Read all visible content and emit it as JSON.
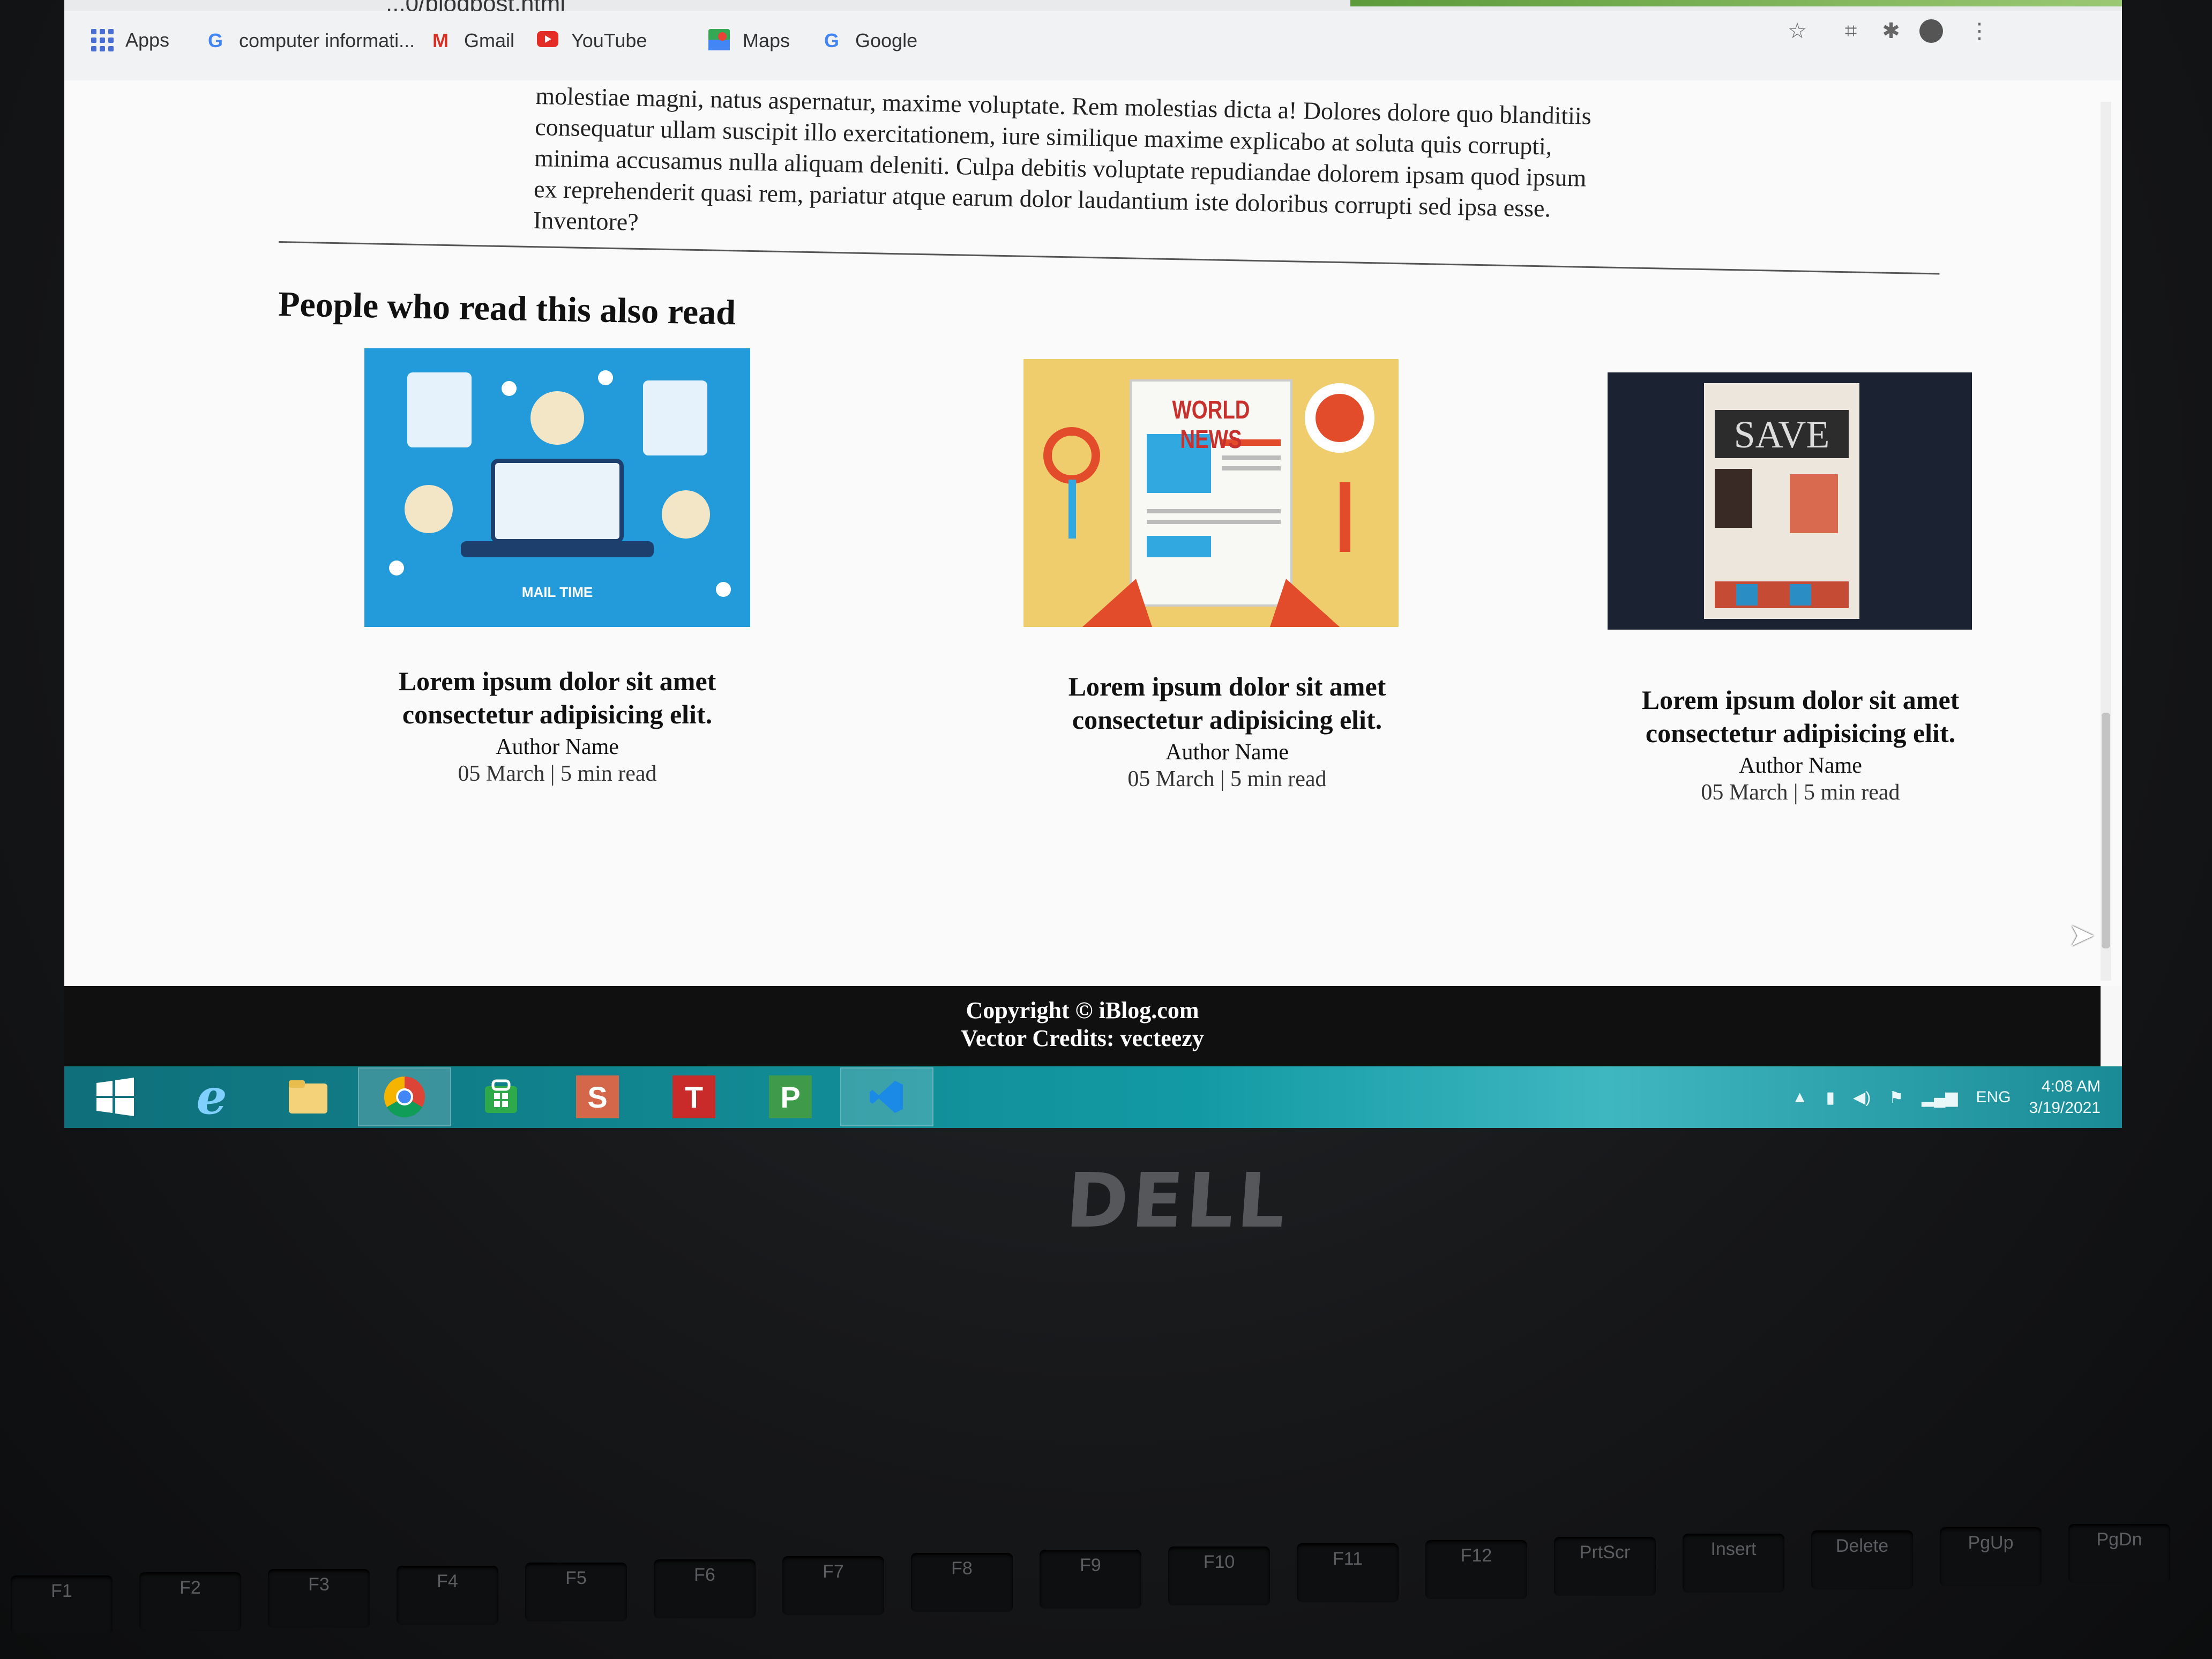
{
  "browser": {
    "url_partial": "...0/blogpost.html",
    "bookmarks": [
      {
        "label": "Apps",
        "icon": "apps-grid-icon"
      },
      {
        "label": "computer informati...",
        "icon": "google-g-icon"
      },
      {
        "label": "Gmail",
        "icon": "gmail-m-icon"
      },
      {
        "label": "YouTube",
        "icon": "youtube-icon"
      },
      {
        "label": "Maps",
        "icon": "maps-icon"
      },
      {
        "label": "Google",
        "icon": "google-g-icon"
      }
    ],
    "toolbar_icons": [
      "star-icon",
      "camera-icon",
      "extensions-icon",
      "profile-icon",
      "menu-dots-icon"
    ]
  },
  "article": {
    "text_lines": [
      "molestiae magni, natus aspernatur, maxime voluptate. Rem molestias dicta a! Dolores dolore quo blanditiis",
      "consequatur ullam suscipit illo exercitationem, iure similique maxime explicabo at soluta quis corrupti,",
      "minima accusamus nulla aliquam deleniti. Culpa debitis voluptate repudiandae dolorem ipsam quod ipsum",
      "ex reprehenderit quasi rem, pariatur atque earum dolor laudantium iste doloribus corrupti sed ipsa esse.",
      "Inventore?"
    ]
  },
  "related": {
    "heading": "People who read this also read",
    "cards": [
      {
        "title_line1": "Lorem ipsum dolor sit amet",
        "title_line2": "consectetur adipisicing elit.",
        "author": "Author Name",
        "meta": "05 March | 5 min read",
        "image_caption": "MAIL TIME"
      },
      {
        "title_line1": "Lorem ipsum dolor sit amet",
        "title_line2": "consectetur adipisicing elit.",
        "author": "Author Name",
        "meta": "05 March | 5 min read",
        "image_caption": "WORLD NEWS"
      },
      {
        "title_line1": "Lorem ipsum dolor sit amet",
        "title_line2": "consectetur adipisicing elit.",
        "author": "Author Name",
        "meta": "05 March | 5 min read",
        "image_caption": "SAVE"
      }
    ]
  },
  "footer": {
    "copyright": "Copyright © iBlog.com",
    "credits": "Vector Credits: vecteezy"
  },
  "taskbar": {
    "apps": [
      "windows-start-icon",
      "internet-explorer-icon",
      "file-explorer-icon",
      "chrome-icon",
      "store-icon",
      "s-app-icon",
      "t-app-icon",
      "p-app-icon",
      "vscode-icon"
    ],
    "language": "ENG",
    "time": "4:08 AM",
    "date": "3/19/2021"
  },
  "hardware": {
    "brand": "DELL",
    "fn_keys": [
      "F1",
      "F2",
      "F3",
      "F4",
      "F5",
      "F6",
      "F7",
      "F8",
      "F9",
      "F10",
      "F11",
      "F12",
      "PrtScr",
      "Insert",
      "Delete",
      "PgUp",
      "PgDn"
    ]
  }
}
